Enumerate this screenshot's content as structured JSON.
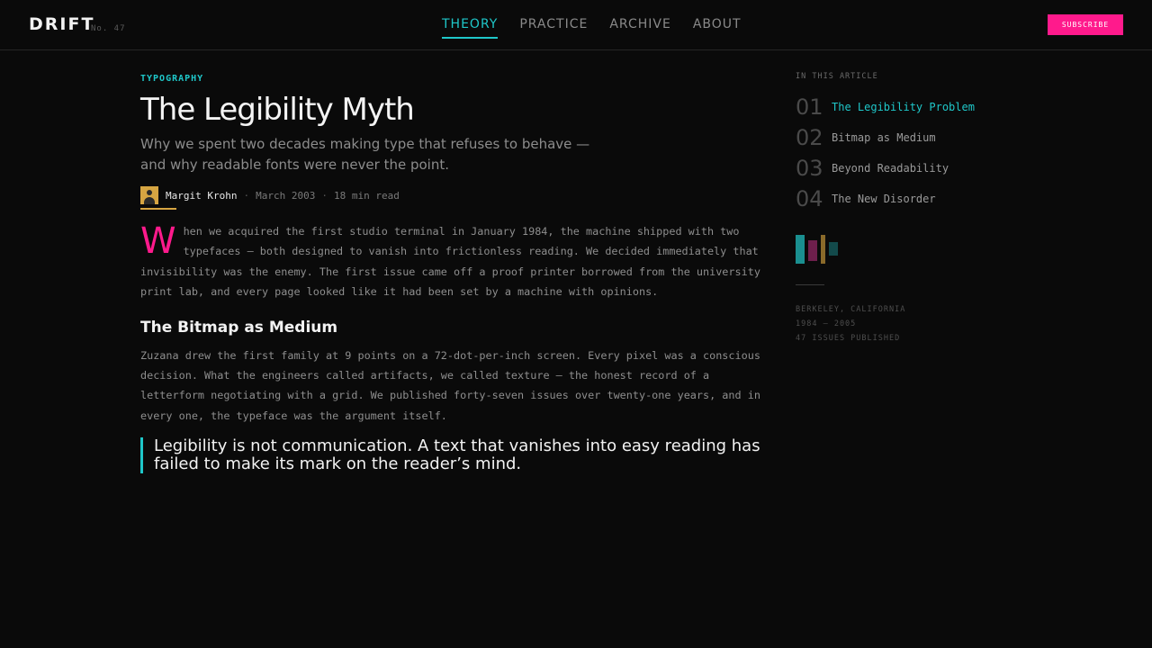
{
  "brand": {
    "logo": "DRIFT",
    "issue": "No. 47"
  },
  "nav": {
    "items": [
      {
        "label": "THEORY",
        "active": true
      },
      {
        "label": "PRACTICE",
        "active": false
      },
      {
        "label": "ARCHIVE",
        "active": false
      },
      {
        "label": "ABOUT",
        "active": false
      }
    ],
    "subscribe_label": "SUBSCRIBE"
  },
  "article": {
    "category": "TYPOGRAPHY",
    "title": "The Legibility Myth",
    "subtitle": "Why we spent two decades making type that refuses to behave — and why readable fonts were never the point.",
    "author": "Margit Krohn",
    "date": "March 2003",
    "read_time": "18 min read",
    "dropcap": "W",
    "para1": "hen we acquired the first studio terminal in January 1984, the machine shipped with two typefaces — both designed to vanish into frictionless reading. We decided immediately that invisibility was the enemy. The first issue came off a proof printer borrowed from the university print lab, and every page looked like it had been set by a machine with opinions.",
    "section_heading": "The Bitmap as Medium",
    "para2": "Zuzana drew the first family at 9 points on a 72-dot-per-inch screen. Every pixel was a conscious decision. What the engineers called artifacts, we called texture — the honest record of a letterform negotiating with a grid. We published forty-seven issues over twenty-one years, and in every one, the typeface was the argument itself.",
    "pullquote": "Legibility is not communication. A text that vanishes into easy reading has failed to make its mark on the reader’s mind."
  },
  "toc": {
    "heading": "IN THIS ARTICLE",
    "items": [
      {
        "num": "01",
        "label": "The Legibility Problem",
        "active": true
      },
      {
        "num": "02",
        "label": "Bitmap as Medium",
        "active": false
      },
      {
        "num": "03",
        "label": "Beyond Readability",
        "active": false
      },
      {
        "num": "04",
        "label": "The New Disorder",
        "active": false
      }
    ]
  },
  "palette": [
    "#1a8f90",
    "#6e1f4c",
    "#8a6a2a",
    "#134a4b"
  ],
  "colophon": {
    "location": "BERKELEY, CALIFORNIA",
    "years": "1984 — 2005",
    "issues": "47 ISSUES PUBLISHED"
  },
  "colors": {
    "accent_cyan": "#1fc7c9",
    "accent_pink": "#ff1a8c",
    "accent_gold": "#d6a542",
    "background": "#0a0a0a"
  }
}
